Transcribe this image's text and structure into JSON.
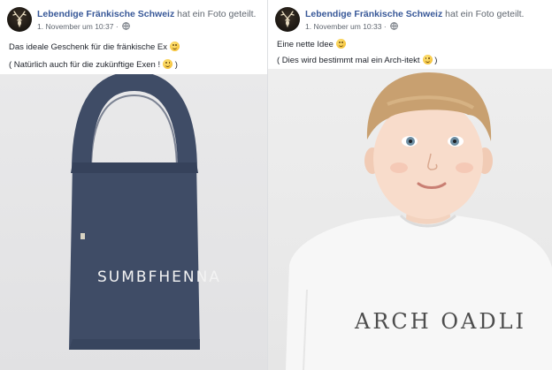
{
  "posts": [
    {
      "author": "Lebendige Fränkische Schweiz",
      "action": "hat ein Foto geteilt.",
      "timestamp": "1. November um 10:37",
      "privacy_icon": "globe-icon",
      "message_line1": "Das ideale Geschenk für die fränkische Ex",
      "message_line2": "( Natürlich auch für die zukünftige Exen !",
      "message_line2_end": ")",
      "photo_print": "SUMBFHENNA"
    },
    {
      "author": "Lebendige Fränkische Schweiz",
      "action": "hat ein Foto geteilt.",
      "timestamp": "1. November um 10:33",
      "privacy_icon": "globe-icon",
      "message_line1": "Eine nette Idee",
      "message_line2": "( Dies wird bestimmt mal ein Arch-itekt",
      "message_line2_end": ")",
      "photo_print": "ARCH OADLI"
    }
  ],
  "colors": {
    "author_link": "#385898",
    "meta_text": "#606770",
    "bag": "#3f4c66",
    "background": "#e9ebee"
  }
}
